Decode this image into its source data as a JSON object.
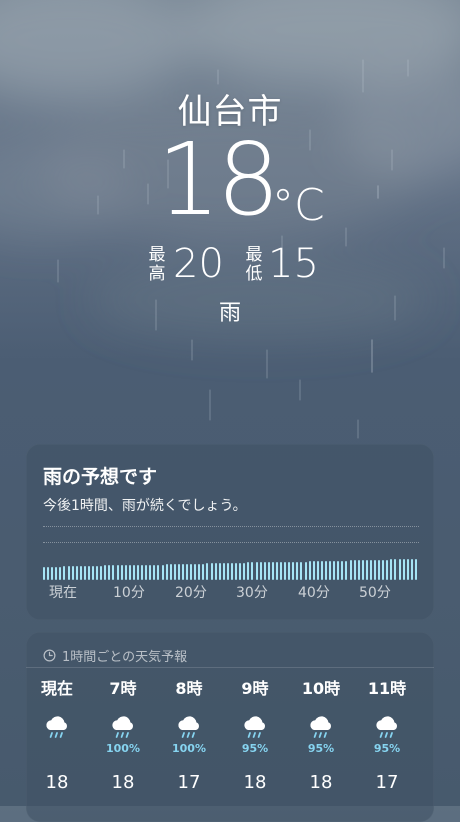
{
  "location": {
    "city": "仙台市",
    "temperature": "18",
    "unit": "°C",
    "high_label": "最高",
    "high": "20",
    "low_label": "最低",
    "low": "15",
    "condition": "雨"
  },
  "rain_card": {
    "title": "雨の予想です",
    "subtitle": "今後1時間、雨が続くでしょう。",
    "tick_labels": [
      "現在",
      "10分",
      "20分",
      "30分",
      "40分",
      "50分"
    ],
    "bar_color": "#a6e4f5",
    "intensity": [
      0.6,
      0.6,
      0.6,
      0.6,
      0.6,
      0.62,
      0.62,
      0.62,
      0.62,
      0.62,
      0.64,
      0.64,
      0.64,
      0.64,
      0.64,
      0.66,
      0.66,
      0.66,
      0.66,
      0.66,
      0.68,
      0.68,
      0.68,
      0.68,
      0.68,
      0.7,
      0.7,
      0.7,
      0.7,
      0.7,
      0.72,
      0.72,
      0.72,
      0.72,
      0.72,
      0.74,
      0.74,
      0.74,
      0.74,
      0.74,
      0.76,
      0.76,
      0.76,
      0.76,
      0.76,
      0.78,
      0.78,
      0.78,
      0.78,
      0.78,
      0.8,
      0.8,
      0.8,
      0.8,
      0.8,
      0.82,
      0.82,
      0.82,
      0.82,
      0.82,
      0.84,
      0.84,
      0.84,
      0.84,
      0.84,
      0.86,
      0.86,
      0.86,
      0.86,
      0.86,
      0.88,
      0.88,
      0.88,
      0.88,
      0.88,
      0.9,
      0.9,
      0.9,
      0.9,
      0.9,
      0.92,
      0.92,
      0.92,
      0.92,
      0.92,
      0.94,
      0.94,
      0.94,
      0.94,
      0.94,
      0.96,
      0.96
    ]
  },
  "hourly": {
    "header": "1時間ごとの天気予報",
    "icon": "clock-icon",
    "hours": [
      {
        "time": "現在",
        "icon": "rain-cloud-icon",
        "precip": "",
        "temp": "18"
      },
      {
        "time": "7時",
        "icon": "rain-cloud-icon",
        "precip": "100%",
        "temp": "18"
      },
      {
        "time": "8時",
        "icon": "rain-cloud-icon",
        "precip": "100%",
        "temp": "17"
      },
      {
        "time": "9時",
        "icon": "rain-cloud-icon",
        "precip": "95%",
        "temp": "18"
      },
      {
        "time": "10時",
        "icon": "rain-cloud-icon",
        "precip": "95%",
        "temp": "18"
      },
      {
        "time": "11時",
        "icon": "rain-cloud-icon",
        "precip": "95%",
        "temp": "17"
      }
    ]
  }
}
